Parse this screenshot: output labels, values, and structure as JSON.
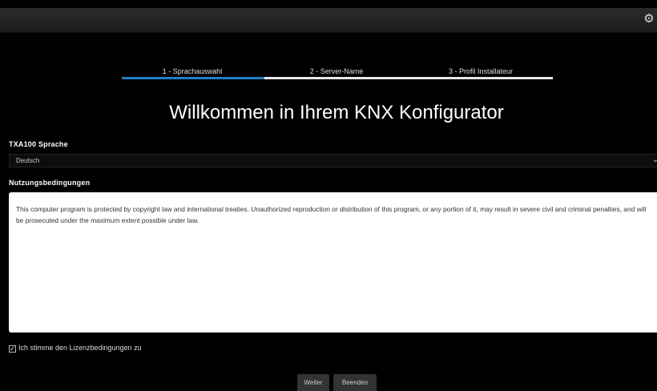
{
  "header": {
    "settings_icon": "gear-icon"
  },
  "wizard": {
    "steps": [
      {
        "label": "1 - Sprachauswahl",
        "active": true
      },
      {
        "label": "2 - Server-Name",
        "active": false
      },
      {
        "label": "3 - Profil Installateur",
        "active": false
      }
    ],
    "accent_color": "#1e7fc6"
  },
  "main": {
    "title": "Willkommen in Ihrem KNX Konfigurator",
    "language_label": "TXA100 Sprache",
    "language_value": "Deutsch",
    "terms_label": "Nutzungsbedingungen",
    "terms_text": "This computer program is protected by copyright law and international treaties. Unauthorized reproduction or distribution of this program, or any portion of it, may result in severe civil and criminal penalties, and will be prosecuted under the maximum extent possible under law.",
    "accept_label": "Ich stimme den Lizenzbedingungen zu",
    "accept_checked": true
  },
  "actions": {
    "next_label": "Weiter",
    "quit_label": "Beenden"
  }
}
